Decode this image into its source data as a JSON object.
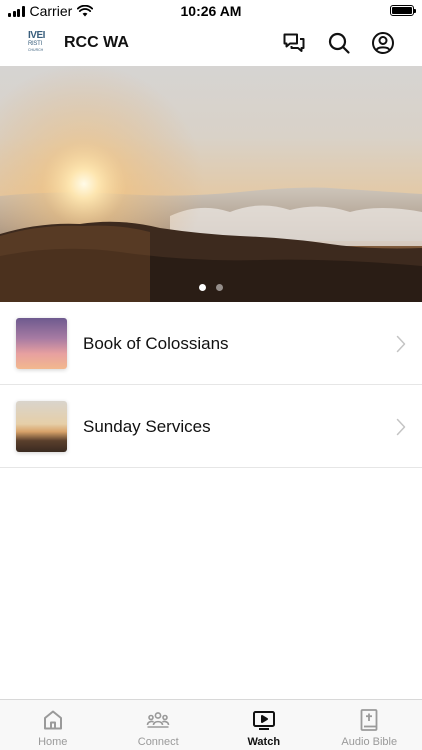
{
  "status_bar": {
    "carrier": "Carrier",
    "time": "10:26 AM",
    "icons": [
      "signal-icon",
      "wifi-icon",
      "battery-icon"
    ]
  },
  "header": {
    "logo": {
      "line1": "IVEI",
      "line2": "RISTI",
      "line3": "CHURCH"
    },
    "title": "RCC WA",
    "actions": [
      "chat-icon",
      "search-icon",
      "profile-icon"
    ]
  },
  "hero": {
    "carousel_count": 2,
    "active_index": 0
  },
  "list": {
    "items": [
      {
        "label": "Book of Colossians",
        "thumbnail": "sunset-sky-thumbnail"
      },
      {
        "label": "Sunday Services",
        "thumbnail": "sunrise-mountain-thumbnail"
      }
    ]
  },
  "tab_bar": {
    "tabs": [
      {
        "label": "Home",
        "icon": "home-icon",
        "active": false
      },
      {
        "label": "Connect",
        "icon": "people-icon",
        "active": false
      },
      {
        "label": "Watch",
        "icon": "play-icon",
        "active": true
      },
      {
        "label": "Audio Bible",
        "icon": "bible-icon",
        "active": false
      }
    ]
  },
  "colors": {
    "active_tab": "#111111",
    "inactive_tab": "#9a9a9a",
    "logo_blue": "#3a5f7d"
  }
}
